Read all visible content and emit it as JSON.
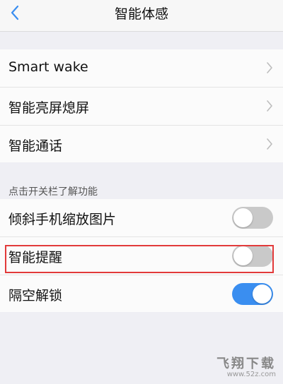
{
  "header": {
    "title": "智能体感",
    "back_icon": "chevron-left-icon"
  },
  "group_a": {
    "items": [
      {
        "label": "Smart wake",
        "icon": "chevron-right-icon"
      },
      {
        "label": "智能亮屏熄屏",
        "icon": "chevron-right-icon"
      },
      {
        "label": "智能通话",
        "icon": "chevron-right-icon"
      }
    ]
  },
  "section_note": "点击开关栏了解功能",
  "group_b": {
    "items": [
      {
        "label": "倾斜手机缩放图片",
        "toggle": "off"
      },
      {
        "label": "智能提醒",
        "toggle": "off",
        "highlighted": true
      },
      {
        "label": "隔空解锁",
        "toggle": "on"
      }
    ]
  },
  "watermark": {
    "logo": "飞翔下载",
    "url": "www.52z.com"
  },
  "colors": {
    "toggle_on": "#3a8ef0",
    "toggle_off": "#c9c9c9",
    "highlight_border": "#e23a3a",
    "back_chevron": "#3a8ef0"
  }
}
